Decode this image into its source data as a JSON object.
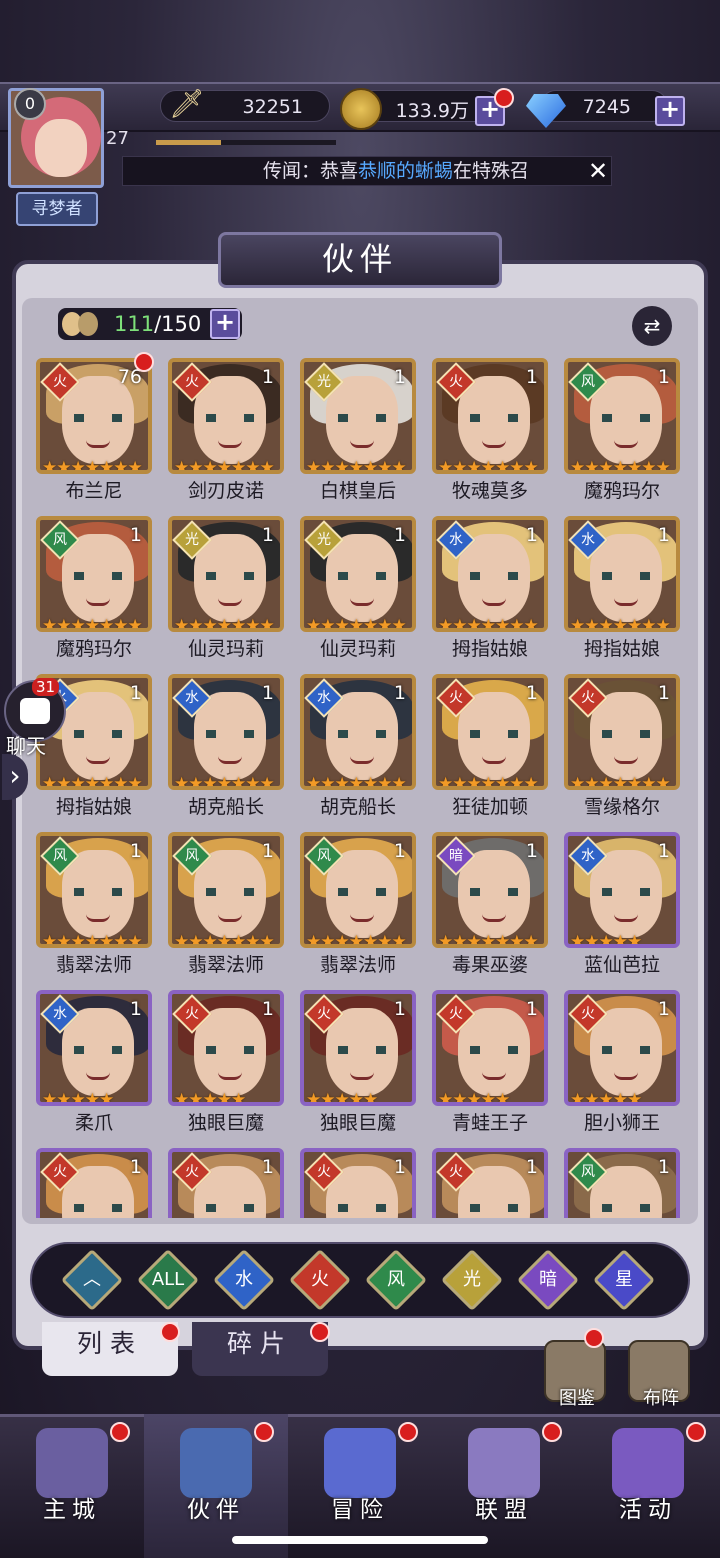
{
  "player": {
    "level": "27",
    "vip": "0",
    "title": "寻梦者",
    "xp_fraction": 0.36
  },
  "resources": {
    "power": "32251",
    "gold": "133.9万",
    "gems": "7245",
    "plus": "+"
  },
  "news": {
    "prefix": "传闻：恭喜",
    "highlight": "恭顺的蜥蜴",
    "suffix": "在特殊召"
  },
  "panel": {
    "title": "伙伴",
    "count_current": "111",
    "count_total": "/150",
    "plus": "+"
  },
  "partners": [
    {
      "name": "布兰尼",
      "level": "76",
      "element": "fire",
      "stars": 7,
      "hair": "#c9a066",
      "frame": "gold"
    },
    {
      "name": "剑刃皮诺",
      "level": "1",
      "element": "fire",
      "stars": 7,
      "hair": "#3b2b22",
      "frame": "gold"
    },
    {
      "name": "白棋皇后",
      "level": "1",
      "element": "light",
      "stars": 7,
      "hair": "#d7d2cc",
      "frame": "gold"
    },
    {
      "name": "牧魂莫多",
      "level": "1",
      "element": "fire",
      "stars": 7,
      "hair": "#5b3a24",
      "frame": "gold"
    },
    {
      "name": "魔鸦玛尔",
      "level": "1",
      "element": "wind",
      "stars": 7,
      "hair": "#b45c3e",
      "frame": "gold"
    },
    {
      "name": "魔鸦玛尔",
      "level": "1",
      "element": "wind",
      "stars": 7,
      "hair": "#b45c3e",
      "frame": "gold"
    },
    {
      "name": "仙灵玛莉",
      "level": "1",
      "element": "light",
      "stars": 7,
      "hair": "#2a2a2a",
      "frame": "gold"
    },
    {
      "name": "仙灵玛莉",
      "level": "1",
      "element": "light",
      "stars": 7,
      "hair": "#2a2a2a",
      "frame": "gold"
    },
    {
      "name": "拇指姑娘",
      "level": "1",
      "element": "water",
      "stars": 7,
      "hair": "#e3c27a",
      "frame": "gold"
    },
    {
      "name": "拇指姑娘",
      "level": "1",
      "element": "water",
      "stars": 7,
      "hair": "#e3c27a",
      "frame": "gold"
    },
    {
      "name": "拇指姑娘",
      "level": "1",
      "element": "water",
      "stars": 7,
      "hair": "#e3c27a",
      "frame": "gold"
    },
    {
      "name": "胡克船长",
      "level": "1",
      "element": "water",
      "stars": 7,
      "hair": "#2d3440",
      "frame": "gold"
    },
    {
      "name": "胡克船长",
      "level": "1",
      "element": "water",
      "stars": 7,
      "hair": "#2d3440",
      "frame": "gold"
    },
    {
      "name": "狂徒加顿",
      "level": "1",
      "element": "fire",
      "stars": 7,
      "hair": "#d9a84a",
      "frame": "gold"
    },
    {
      "name": "雪缘格尔",
      "level": "1",
      "element": "fire",
      "stars": 7,
      "hair": "#6a5236",
      "frame": "gold"
    },
    {
      "name": "翡翠法师",
      "level": "1",
      "element": "wind",
      "stars": 7,
      "hair": "#d8a24c",
      "frame": "gold"
    },
    {
      "name": "翡翠法师",
      "level": "1",
      "element": "wind",
      "stars": 7,
      "hair": "#d8a24c",
      "frame": "gold"
    },
    {
      "name": "翡翠法师",
      "level": "1",
      "element": "wind",
      "stars": 7,
      "hair": "#d8a24c",
      "frame": "gold"
    },
    {
      "name": "毒果巫婆",
      "level": "1",
      "element": "dark",
      "stars": 7,
      "hair": "#6e6c6a",
      "frame": "gold"
    },
    {
      "name": "蓝仙芭拉",
      "level": "1",
      "element": "water",
      "stars": 5,
      "hair": "#d8b46a",
      "frame": "purple"
    },
    {
      "name": "柔爪",
      "level": "1",
      "element": "water",
      "stars": 5,
      "hair": "#2e2c3c",
      "frame": "purple"
    },
    {
      "name": "独眼巨魔",
      "level": "1",
      "element": "fire",
      "stars": 5,
      "hair": "#6a2c24",
      "frame": "purple"
    },
    {
      "name": "独眼巨魔",
      "level": "1",
      "element": "fire",
      "stars": 5,
      "hair": "#6a2c24",
      "frame": "purple"
    },
    {
      "name": "青蛙王子",
      "level": "1",
      "element": "fire",
      "stars": 5,
      "hair": "#c45a4a",
      "frame": "purple"
    },
    {
      "name": "胆小狮王",
      "level": "1",
      "element": "fire",
      "stars": 5,
      "hair": "#c98c4a",
      "frame": "purple"
    },
    {
      "name": "",
      "level": "1",
      "element": "fire",
      "stars": 0,
      "hair": "#c98c4a",
      "frame": "purple"
    },
    {
      "name": "",
      "level": "1",
      "element": "fire",
      "stars": 0,
      "hair": "#b88a5a",
      "frame": "purple"
    },
    {
      "name": "",
      "level": "1",
      "element": "fire",
      "stars": 0,
      "hair": "#b88a5a",
      "frame": "purple"
    },
    {
      "name": "",
      "level": "1",
      "element": "fire",
      "stars": 0,
      "hair": "#b88a5a",
      "frame": "purple"
    },
    {
      "name": "",
      "level": "1",
      "element": "wind",
      "stars": 0,
      "hair": "#8a6a4a",
      "frame": "purple"
    }
  ],
  "element_colors": {
    "fire": "#c3382a",
    "water": "#2f63c7",
    "wind": "#2f8a4b",
    "light": "#b8a13a",
    "dark": "#7a4ac0",
    "cosmic": "#4a4ac8"
  },
  "element_glyphs": {
    "fire": "火",
    "water": "水",
    "wind": "风",
    "light": "光",
    "dark": "暗",
    "cosmic": "星"
  },
  "filters": [
    {
      "id": "rarity",
      "label": "︿",
      "color": "#2c6a8a"
    },
    {
      "id": "all",
      "label": "ALL",
      "color": "#2a7a4a"
    },
    {
      "id": "water",
      "label": "水",
      "color": "#2f63c7"
    },
    {
      "id": "fire",
      "label": "火",
      "color": "#c3382a"
    },
    {
      "id": "wind",
      "label": "风",
      "color": "#2f8a4b"
    },
    {
      "id": "light",
      "label": "光",
      "color": "#b8a13a"
    },
    {
      "id": "dark",
      "label": "暗",
      "color": "#7a4ac0"
    },
    {
      "id": "cosmic",
      "label": "星",
      "color": "#4a4ac8"
    }
  ],
  "tabs": {
    "list": "列表",
    "fragments": "碎片"
  },
  "tools": {
    "codex": "图鉴",
    "formation": "布阵"
  },
  "chat": {
    "label": "聊天",
    "count": "31"
  },
  "nav": [
    {
      "label": "主城",
      "icon": "castle-icon",
      "color": "#6a5fa0"
    },
    {
      "label": "伙伴",
      "icon": "witch-hat-icon",
      "color": "#4a6ab0"
    },
    {
      "label": "冒险",
      "icon": "compass-icon",
      "color": "#5a6ad0"
    },
    {
      "label": "联盟",
      "icon": "shield-icon",
      "color": "#8a7ac0"
    },
    {
      "label": "活动",
      "icon": "cards-icon",
      "color": "#7a5ac0"
    }
  ]
}
